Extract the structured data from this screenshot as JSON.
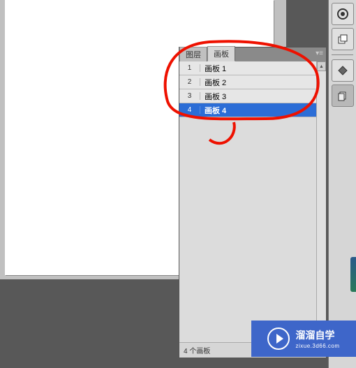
{
  "tabs": [
    {
      "label": "图层",
      "active": false
    },
    {
      "label": "画板",
      "active": true
    }
  ],
  "artboards": [
    {
      "num": "1",
      "name": "画板 1",
      "selected": false
    },
    {
      "num": "2",
      "name": "画板 2",
      "selected": false
    },
    {
      "num": "3",
      "name": "画板 3",
      "selected": false
    },
    {
      "num": "4",
      "name": "画板 4",
      "selected": true
    }
  ],
  "status": {
    "count_text": "4 个画板"
  },
  "watermark": {
    "line1": "溜溜自学",
    "line2": "zixue.3d66.com"
  }
}
